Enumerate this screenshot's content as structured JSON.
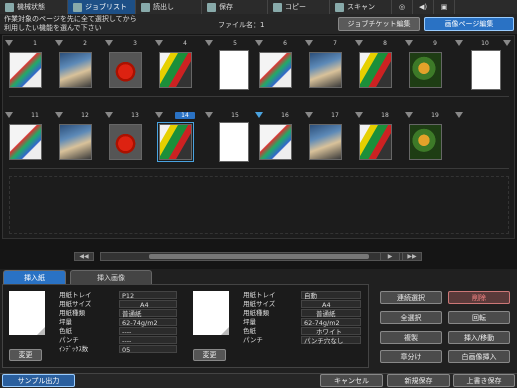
{
  "topbar": {
    "tabs": [
      {
        "label": "機械状態",
        "icon": "machine-status-icon",
        "active": false
      },
      {
        "label": "ジョブリスト",
        "icon": "job-list-icon",
        "active": true
      },
      {
        "label": "読出し",
        "icon": "recall-icon",
        "active": false
      },
      {
        "label": "保存",
        "icon": "save-icon",
        "active": false
      },
      {
        "label": "コピー",
        "icon": "copy-icon",
        "active": false
      },
      {
        "label": "スキャン",
        "icon": "scan-icon",
        "active": false
      }
    ],
    "right_icons": [
      "globe-icon",
      "volume-icon",
      "settings-icon"
    ]
  },
  "header": {
    "instruction": "作業対象のページを先に全て選択してから\n利用したい機能を選んで下さい",
    "file_label": "ファイル名：1",
    "job_ticket_edit": "ジョブチケット編集",
    "image_page_edit": "画像ページ編集"
  },
  "pages": {
    "row1": [
      "1",
      "2",
      "3",
      "4",
      "5",
      "6",
      "7",
      "8",
      "9",
      "10"
    ],
    "row2": [
      "11",
      "12",
      "13",
      "14",
      "15",
      "16",
      "17",
      "18",
      "19"
    ],
    "selected": "14"
  },
  "scroll": {
    "prev_fast": "◀◀",
    "prev": "◀",
    "next": "▶",
    "next_fast": "▶▶"
  },
  "lower": {
    "tab_insert_paper": "挿入紙",
    "tab_insert_image": "挿入画像",
    "left_info": {
      "labels": [
        "用紙トレイ",
        "用紙サイズ",
        "用紙種類",
        "坪量",
        "色紙",
        "パンチ",
        "ｲﾝﾃﾞｯｸｽ数"
      ],
      "values": [
        "P12",
        "A4",
        "普通紙",
        "62-74g/m2",
        "----",
        "----",
        "05"
      ]
    },
    "right_info": {
      "labels": [
        "用紙トレイ",
        "用紙サイズ",
        "用紙種類",
        "坪量",
        "色紙",
        "パンチ"
      ],
      "values": [
        "自動",
        "A4",
        "普通紙",
        "62-74g/m2",
        "ホワイト",
        "パンチ穴なし"
      ]
    },
    "change_left": "変更",
    "change_right": "変更",
    "buttons": {
      "continuous_select": "連続選択",
      "delete": "削除",
      "select_all": "全選択",
      "rotate": "回転",
      "duplicate": "複製",
      "insert_move": "挿入/移動",
      "chapter": "章分け",
      "blank_image_insert": "白画像挿入"
    }
  },
  "bottom": {
    "sample_output": "サンプル出力",
    "cancel": "キャンセル",
    "new_save": "新規保存",
    "overwrite_save": "上書き保存"
  }
}
